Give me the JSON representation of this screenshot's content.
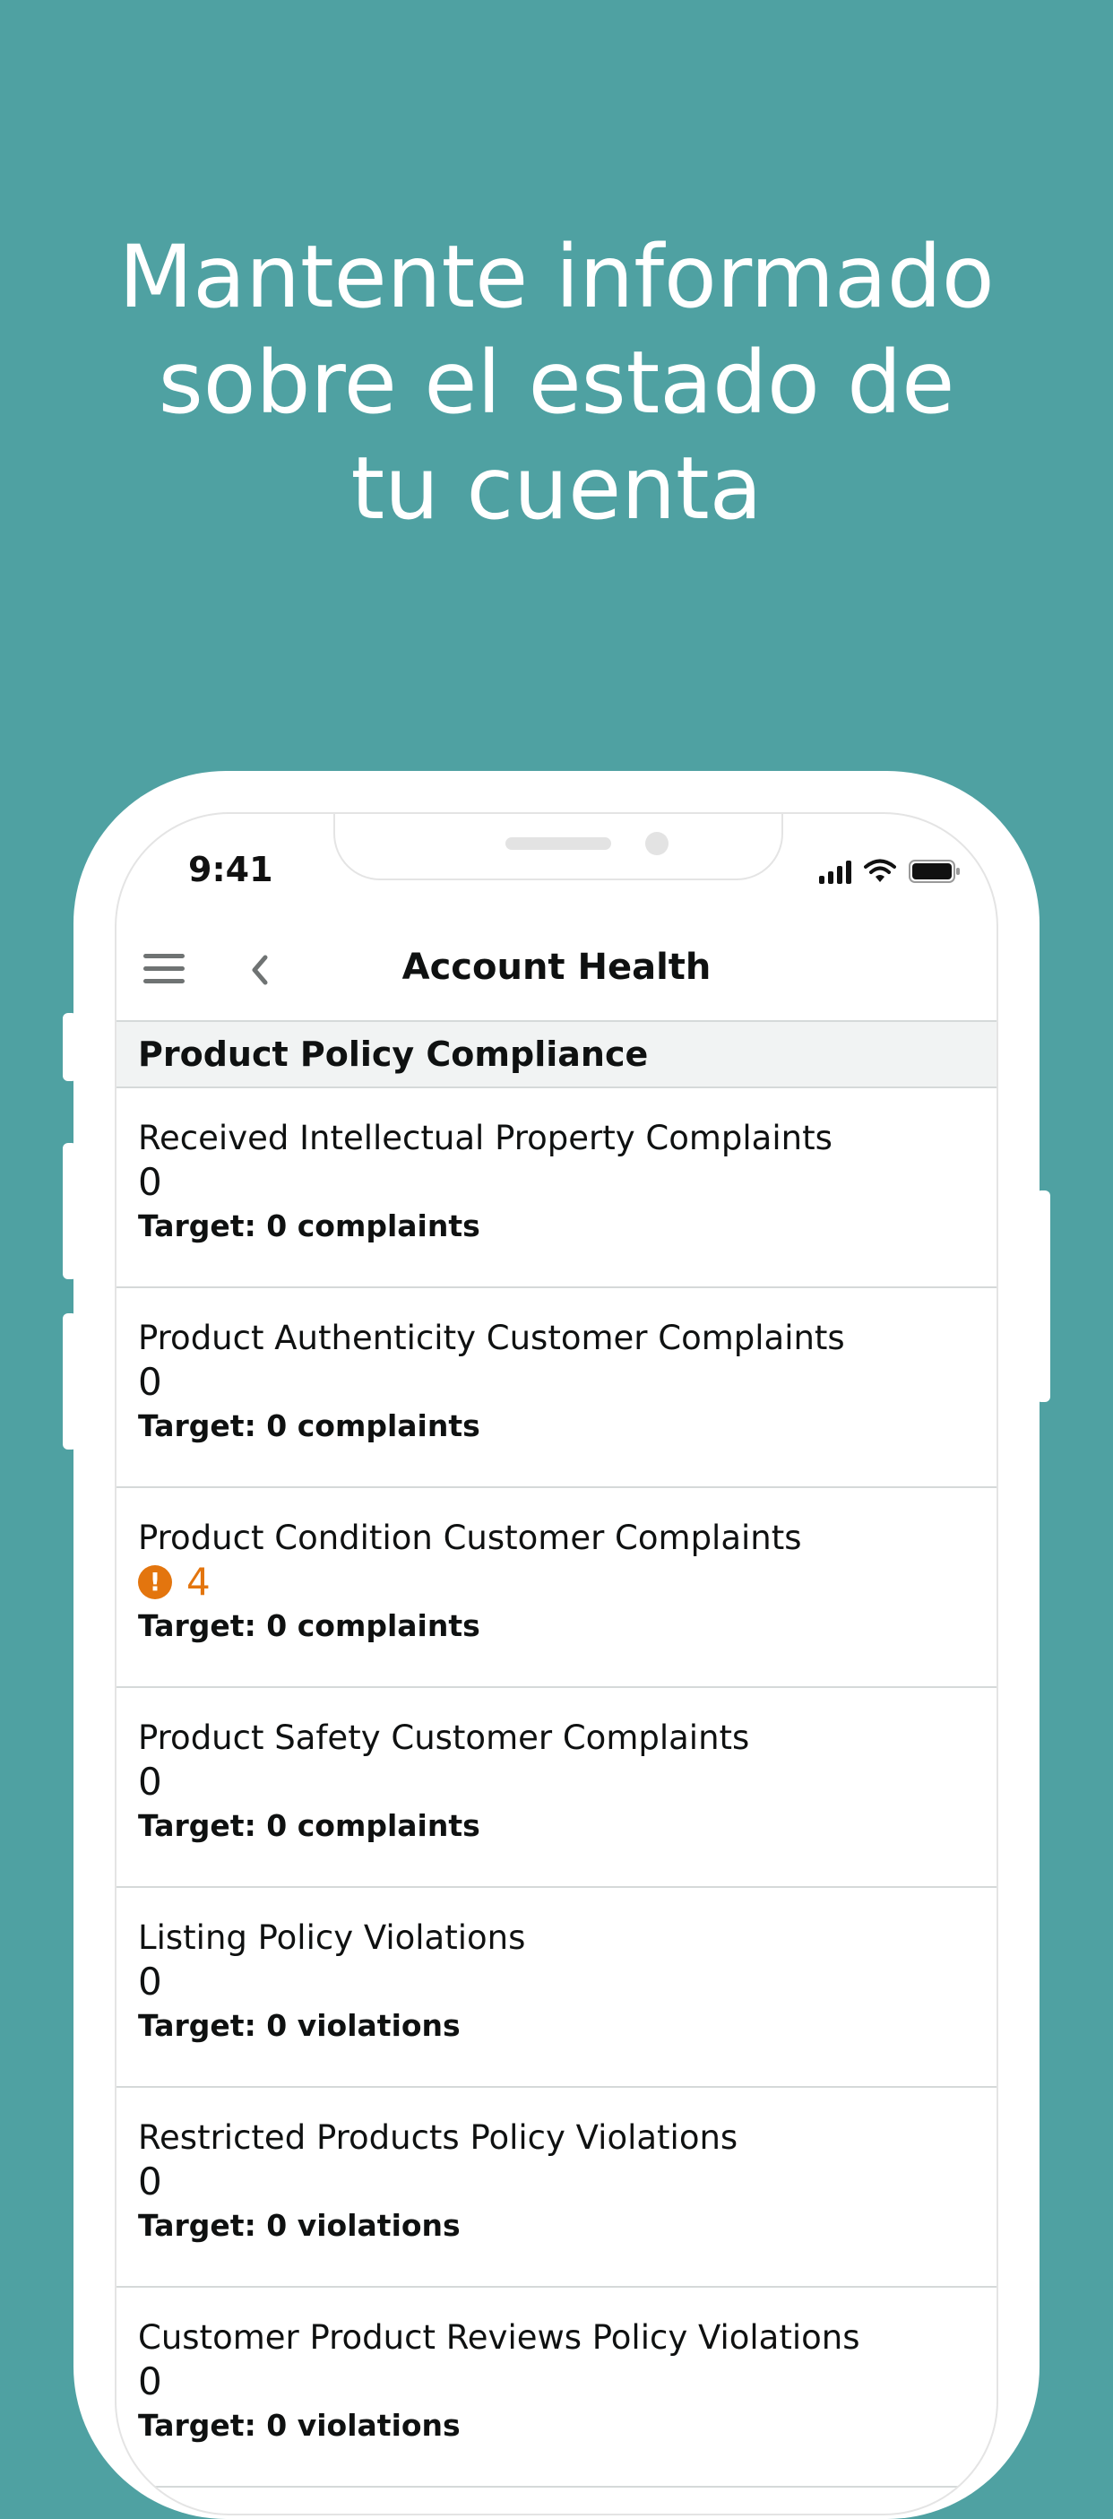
{
  "headline": {
    "lines": [
      "Mantente informado",
      "sobre el estado de",
      "tu cuenta"
    ]
  },
  "status_bar": {
    "time": "9:41"
  },
  "navbar": {
    "title": "Account Health"
  },
  "section": {
    "title": "Product Policy Compliance"
  },
  "metrics": [
    {
      "label": "Received Intellectual Property Complaints",
      "value": "0",
      "target": "Target: 0 complaints",
      "alert": false
    },
    {
      "label": "Product Authenticity Customer Complaints",
      "value": "0",
      "target": "Target: 0 complaints",
      "alert": false
    },
    {
      "label": "Product Condition Customer Complaints",
      "value": "4",
      "target": "Target: 0 complaints",
      "alert": true
    },
    {
      "label": "Product Safety Customer Complaints",
      "value": "0",
      "target": "Target: 0 complaints",
      "alert": false
    },
    {
      "label": "Listing Policy Violations",
      "value": "0",
      "target": "Target: 0 violations",
      "alert": false
    },
    {
      "label": "Restricted Products Policy Violations",
      "value": "0",
      "target": "Target: 0 violations",
      "alert": false
    },
    {
      "label": "Customer Product Reviews Policy Violations",
      "value": "0",
      "target": "Target: 0 violations",
      "alert": false
    }
  ],
  "colors": {
    "background": "#4fa1a2",
    "alert": "#e3750e",
    "text": "#0f1111",
    "divider": "#d5d9d9"
  },
  "icons": {
    "menu": "hamburger-menu-icon",
    "back": "chevron-left-icon",
    "alert": "exclamation-circle-icon",
    "signal": "cellular-signal-icon",
    "wifi": "wifi-icon",
    "battery": "battery-icon"
  }
}
